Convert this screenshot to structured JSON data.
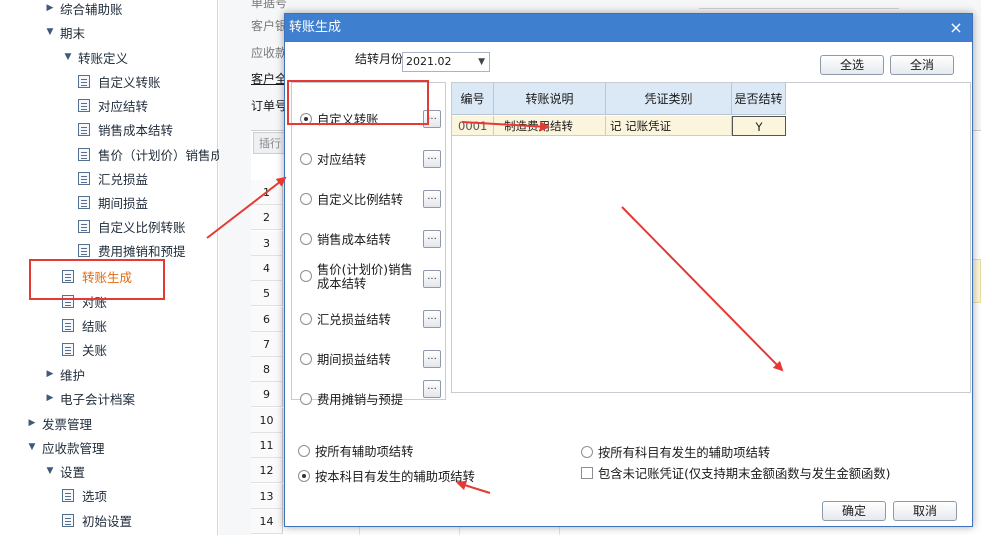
{
  "tree": {
    "items": [
      {
        "label": "综合辅助账",
        "kind": "group",
        "expanded": false
      },
      {
        "label": "期末",
        "kind": "group",
        "expanded": true
      },
      {
        "label": "转账定义",
        "kind": "group",
        "expanded": true
      },
      {
        "label": "自定义转账",
        "kind": "doc"
      },
      {
        "label": "对应结转",
        "kind": "doc"
      },
      {
        "label": "销售成本结转",
        "kind": "doc"
      },
      {
        "label": "售价（计划价）销售成本结",
        "kind": "doc"
      },
      {
        "label": "汇兑损益",
        "kind": "doc"
      },
      {
        "label": "期间损益",
        "kind": "doc"
      },
      {
        "label": "自定义比例转账",
        "kind": "doc"
      },
      {
        "label": "费用摊销和预提",
        "kind": "doc"
      },
      {
        "label": "转账生成",
        "kind": "doc",
        "active": true
      },
      {
        "label": "对账",
        "kind": "doc"
      },
      {
        "label": "结账",
        "kind": "doc"
      },
      {
        "label": "关账",
        "kind": "doc"
      },
      {
        "label": "维护",
        "kind": "group",
        "expanded": false
      },
      {
        "label": "电子会计档案",
        "kind": "group",
        "expanded": false
      },
      {
        "label": "发票管理",
        "kind": "group",
        "expanded": false
      },
      {
        "label": "应收款管理",
        "kind": "group",
        "expanded": true
      },
      {
        "label": "设置",
        "kind": "group",
        "expanded": true
      },
      {
        "label": "选项",
        "kind": "doc"
      },
      {
        "label": "初始设置",
        "kind": "doc"
      }
    ]
  },
  "bg": {
    "labels": [
      "单据号",
      "客户银",
      "应收款",
      "客户全",
      "订单号"
    ],
    "tab": "插行",
    "rows": [
      "1",
      "2",
      "3",
      "4",
      "5",
      "6",
      "7",
      "8",
      "9",
      "10",
      "11",
      "12",
      "13",
      "14"
    ]
  },
  "dialog": {
    "title": "转账生成",
    "close_glyph": "×",
    "month_label": "结转月份",
    "month_value": "2021.02",
    "select_all": "全选",
    "clear_all": "全消",
    "types": [
      {
        "label": "自定义转账",
        "selected": true
      },
      {
        "label": "对应结转",
        "selected": false
      },
      {
        "label": "自定义比例结转",
        "selected": false
      },
      {
        "label": "销售成本结转",
        "selected": false
      },
      {
        "label": "售价(计划价)销售成本结转",
        "selected": false
      },
      {
        "label": "汇兑损益结转",
        "selected": false
      },
      {
        "label": "期间损益结转",
        "selected": false
      },
      {
        "label": "费用摊销与预提",
        "selected": false
      }
    ],
    "dots_label": "...",
    "grid": {
      "headers": [
        "编号",
        "转账说明",
        "凭证类别",
        "是否结转"
      ],
      "rows": [
        [
          "0001",
          "制造费用结转",
          "记 记账凭证",
          "Y"
        ]
      ]
    },
    "options": {
      "opt_all_aux": "按所有辅助项结转",
      "opt_subject_aux": "按本科目有发生的辅助项结转",
      "opt_all_subjects_aux": "按所有科目有发生的辅助项结转",
      "include_unposted": "包含未记账凭证(仅支持期末金额函数与发生金额函数)"
    },
    "ok": "确定",
    "cancel": "取消"
  },
  "colors": {
    "title_bar": "#3f7fcf",
    "annotation": "#e53935",
    "active_tree": "#e06a12",
    "grid_header": "#dbe8f6",
    "grid_row": "#fbf5dd"
  }
}
